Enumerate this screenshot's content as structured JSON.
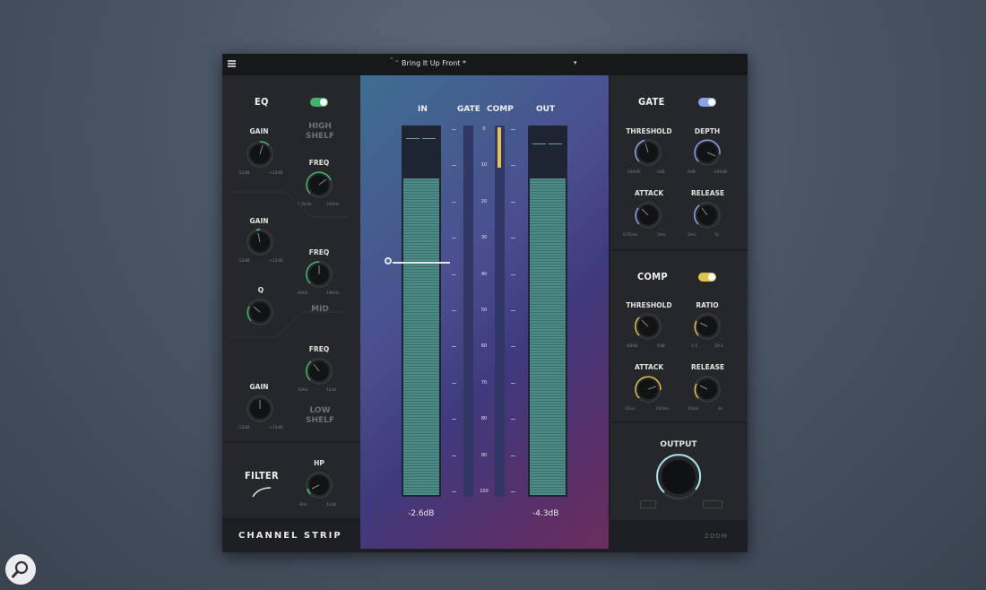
{
  "preset": {
    "name": "Bring It Up Front *",
    "arrows_label": "⌃⌄",
    "dropdown_label": "▾"
  },
  "eq": {
    "title": "EQ",
    "enabled": true,
    "accent": "#3fb56b",
    "high_shelf": {
      "title": "HIGH SHELF",
      "gain_label": "GAIN",
      "gain_min": "-12dB",
      "gain_max": "+12dB",
      "freq_label": "FREQ",
      "freq_min": "1.5kHz",
      "freq_max": "20kHz"
    },
    "mid": {
      "title": "MID",
      "gain_label": "GAIN",
      "gain_min": "-12dB",
      "gain_max": "+12dB",
      "freq_label": "FREQ",
      "freq_min": "40Hz",
      "freq_max": "18kHz",
      "q_label": "Q"
    },
    "low_shelf": {
      "title": "LOW SHELF",
      "gain_label": "GAIN",
      "gain_min": "-12dB",
      "gain_max": "+12dB",
      "freq_label": "FREQ",
      "freq_min": "20Hz",
      "freq_max": "1kHz"
    }
  },
  "filter": {
    "title": "FILTER",
    "hp_label": "HP",
    "hp_min": "0Hz",
    "hp_max": "1kHz"
  },
  "channel_strip_label": "CHANNEL STRIP",
  "meters": {
    "in_label": "IN",
    "gate_label": "GATE",
    "comp_label": "COMP",
    "out_label": "OUT",
    "scale": [
      "0",
      "10",
      "20",
      "30",
      "40",
      "50",
      "60",
      "70",
      "80",
      "90",
      "100"
    ],
    "in_readout": "-2.6dB",
    "out_readout": "-4.3dB",
    "in_level": 0.86,
    "out_level": 0.86,
    "comp_reduction": 0.11
  },
  "gate": {
    "title": "GATE",
    "enabled": true,
    "accent": "#8aa4ea",
    "threshold_label": "THRESHOLD",
    "threshold_min": "-100dB",
    "threshold_max": "0dB",
    "depth_label": "DEPTH",
    "depth_min": "0dB",
    "depth_max": "-100dB",
    "attack_label": "ATTACK",
    "attack_min": "0.05ms",
    "attack_max": "5ms",
    "release_label": "RELEASE",
    "release_min": "5ms",
    "release_max": "5s"
  },
  "comp": {
    "title": "COMP",
    "enabled": true,
    "accent": "#e3c44a",
    "threshold_label": "THRESHOLD",
    "threshold_min": "-60dB",
    "threshold_max": "0dB",
    "ratio_label": "RATIO",
    "ratio_min": "1:1",
    "ratio_max": "20:1",
    "attack_label": "ATTACK",
    "attack_min": "10us",
    "attack_max": "100ms",
    "release_label": "RELEASE",
    "release_min": "10ms",
    "release_max": "4s"
  },
  "output": {
    "label": "OUTPUT",
    "accent": "#a9e6ef"
  },
  "logo_text": "ZOOM",
  "zoom_button_icon": "magnifier-icon"
}
